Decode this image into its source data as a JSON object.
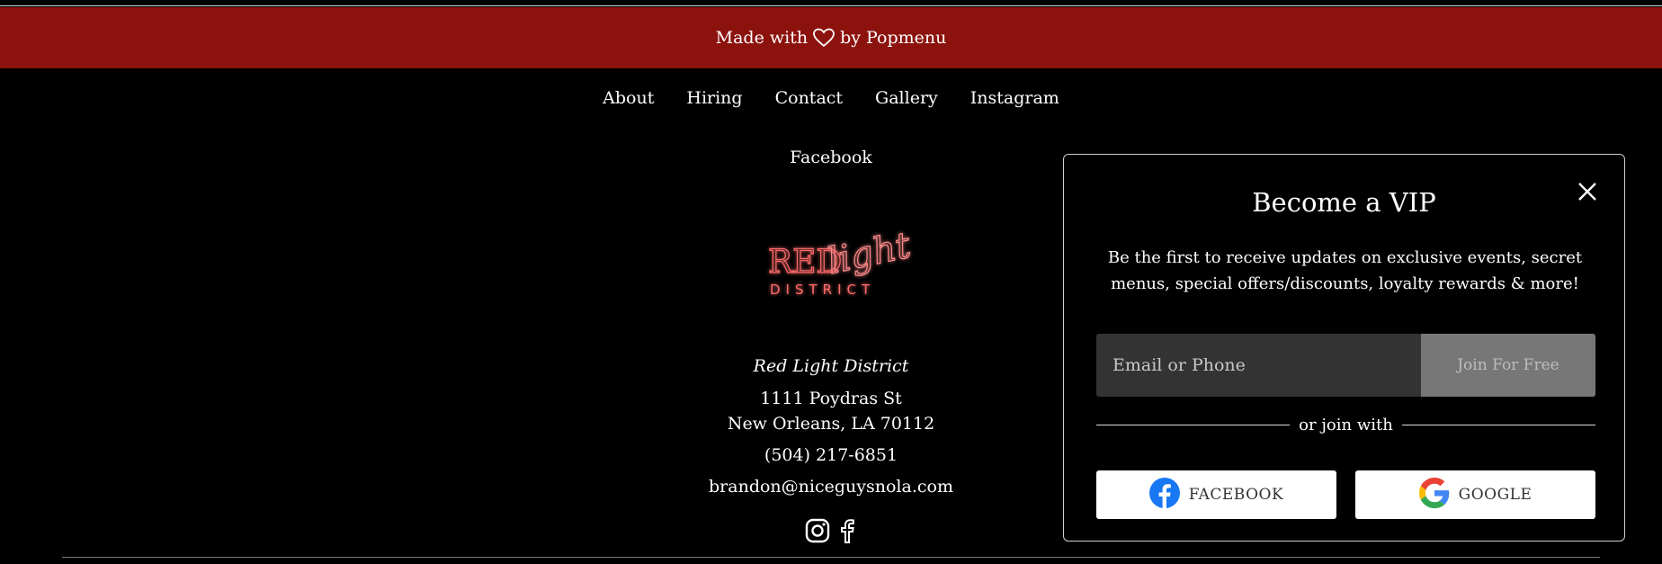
{
  "banner": {
    "prefix": "Made with",
    "suffix": "by Popmenu"
  },
  "nav": {
    "items": [
      "About",
      "Hiring",
      "Contact",
      "Gallery",
      "Instagram",
      "Facebook"
    ]
  },
  "logo": {
    "word_red": "RED",
    "word_light": "light",
    "word_district": "DISTRICT",
    "color": "#ff6b6b"
  },
  "venue": {
    "name": "Red Light District",
    "street": "1111 Poydras St",
    "city": "New Orleans, LA 70112",
    "phone": "(504) 217-6851",
    "email": "brandon@niceguysnola.com"
  },
  "socials": {
    "icons": [
      "instagram-icon",
      "facebook-icon"
    ]
  },
  "vip": {
    "title": "Become a VIP",
    "description": "Be the first to receive updates on exclusive events, secret menus, special offers/discounts, loyalty rewards & more!",
    "input_placeholder": "Email or Phone",
    "join_label": "Join For Free",
    "or_text": "or join with",
    "facebook_label": "FACEBOOK",
    "google_label": "GOOGLE"
  },
  "colors": {
    "banner": "#8c120d",
    "background": "#000000",
    "accent": "#ff6b6b"
  }
}
